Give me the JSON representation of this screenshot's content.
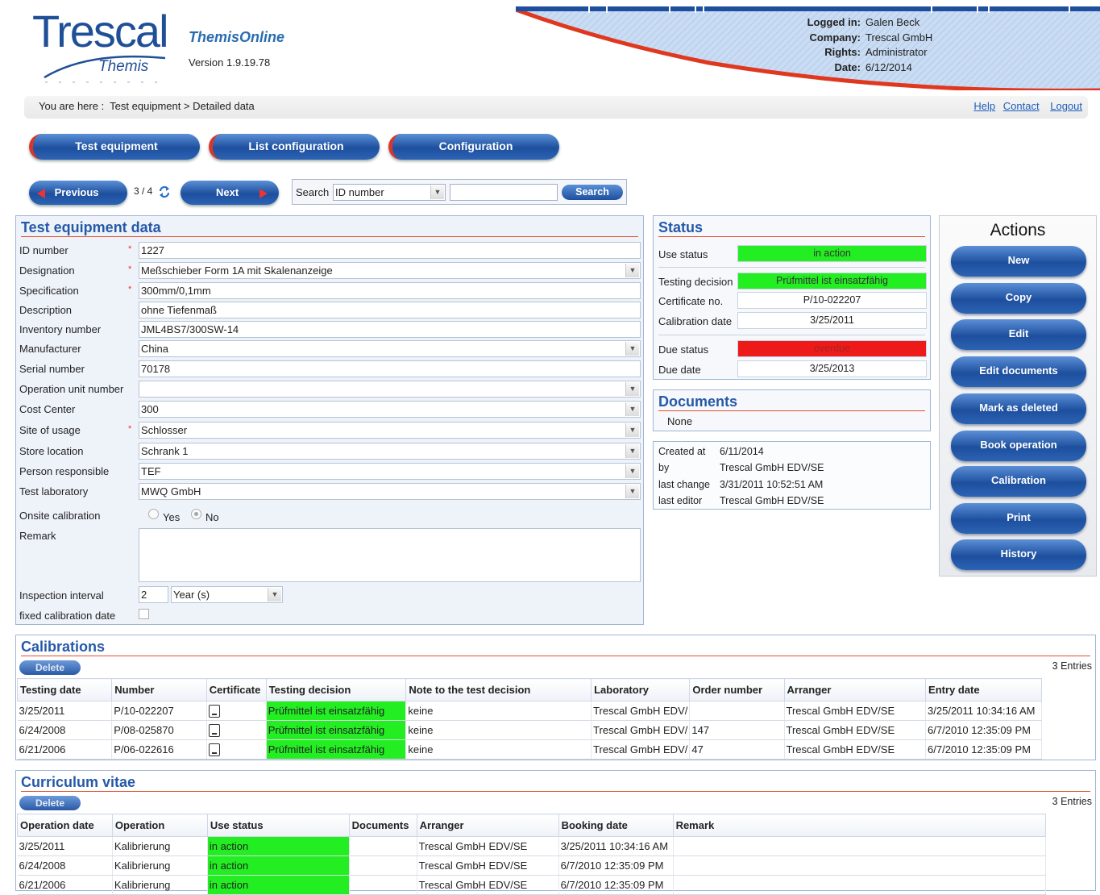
{
  "header": {
    "logo_text": "Trescal",
    "logo_sub": "Themis",
    "app_name": "ThemisOnline",
    "version": "Version 1.9.19.78",
    "user_info": [
      {
        "label": "Logged in:",
        "value": "Galen Beck"
      },
      {
        "label": "Company:",
        "value": "Trescal GmbH"
      },
      {
        "label": "Rights:",
        "value": "Administrator"
      },
      {
        "label": "Date:",
        "value": "6/12/2014"
      }
    ],
    "breadcrumb": "You are here :  Test equipment > Detailed data",
    "links": {
      "help": "Help",
      "contact": "Contact",
      "logout": "Logout"
    }
  },
  "nav": {
    "tabs": [
      "Test equipment",
      "List configuration",
      "Configuration"
    ]
  },
  "pager": {
    "previous": "Previous",
    "position": "3 / 4",
    "next": "Next",
    "search_label": "Search",
    "search_field": "ID number",
    "search_value": "",
    "search_button": "Search"
  },
  "equipment": {
    "title": "Test equipment data",
    "fields": [
      {
        "label": "ID number",
        "value": "1227"
      },
      {
        "label": "Designation",
        "value": "Meßschieber Form 1A mit Skalenanzeige"
      },
      {
        "label": "Specification",
        "value": "300mm/0,1mm"
      },
      {
        "label": "Description",
        "value": "ohne Tiefenmaß"
      },
      {
        "label": "Inventory number",
        "value": "JML4BS7/300SW-14"
      },
      {
        "label": "Manufacturer",
        "value": "China"
      },
      {
        "label": "Serial number",
        "value": "70178"
      },
      {
        "label": "Operation unit number",
        "value": ""
      },
      {
        "label": "Cost Center",
        "value": "300"
      },
      {
        "label": "Site of usage",
        "value": "Schlosser"
      },
      {
        "label": "Store location",
        "value": "Schrank 1"
      },
      {
        "label": "Person responsible",
        "value": "TEF"
      },
      {
        "label": "Test laboratory",
        "value": "MWQ GmbH"
      }
    ],
    "onsite_label": "Onsite calibration",
    "onsite_yes": "Yes",
    "onsite_no": "No",
    "remark_label": "Remark",
    "remark_value": "",
    "interval_label": "Inspection interval",
    "interval_value": "2",
    "interval_unit": "Year (s)",
    "fixed_label": "fixed calibration date"
  },
  "status": {
    "title": "Status",
    "use_status_label": "Use status",
    "use_status": "in action",
    "testing_decision_label": "Testing decision",
    "testing_decision": "Prüfmittel ist einsatzfähig",
    "certificate_label": "Certificate no.",
    "certificate": "P/10-022207",
    "calibration_date_label": "Calibration date",
    "calibration_date": "3/25/2011",
    "due_status_label": "Due status",
    "due_status": "overdue",
    "due_date_label": "Due date",
    "due_date": "3/25/2013",
    "colors": {
      "ok": "#22ee22",
      "overdue": "#ee1a1a"
    }
  },
  "documents": {
    "title": "Documents",
    "value": "None"
  },
  "meta": {
    "created_label": "Created at",
    "created": "6/11/2014",
    "by_label": "by",
    "by": "Trescal GmbH EDV/SE",
    "last_change_label": "last change",
    "last_change": "3/31/2011 10:52:51 AM",
    "last_editor_label": "last editor",
    "last_editor": "Trescal GmbH EDV/SE"
  },
  "actions": {
    "title": "Actions",
    "buttons": [
      "New",
      "Copy",
      "Edit",
      "Edit documents",
      "Mark as deleted",
      "Book operation",
      "Calibration",
      "Print",
      "History"
    ]
  },
  "calibrations": {
    "title": "Calibrations",
    "delete": "Delete",
    "entries": "3 Entries",
    "columns": [
      "Testing date",
      "Number",
      "Certificate",
      "Testing decision",
      "Note to the test decision",
      "Laboratory",
      "Order number",
      "Arranger",
      "Entry date"
    ],
    "rows": [
      [
        "3/25/2011",
        "P/10-022207",
        "",
        "Prüfmittel ist einsatzfähig",
        "keine",
        "Trescal GmbH EDV/",
        "",
        "Trescal GmbH EDV/SE",
        "3/25/2011 10:34:16 AM"
      ],
      [
        "6/24/2008",
        "P/08-025870",
        "",
        "Prüfmittel ist einsatzfähig",
        "keine",
        "Trescal GmbH EDV/",
        "147",
        "Trescal GmbH EDV/SE",
        "6/7/2010 12:35:09 PM"
      ],
      [
        "6/21/2006",
        "P/06-022616",
        "",
        "Prüfmittel ist einsatzfähig",
        "keine",
        "Trescal GmbH EDV/",
        "47",
        "Trescal GmbH EDV/SE",
        "6/7/2010 12:35:09 PM"
      ]
    ]
  },
  "cv": {
    "title": "Curriculum vitae",
    "delete": "Delete",
    "entries": "3 Entries",
    "columns": [
      "Operation date",
      "Operation",
      "Use status",
      "Documents",
      "Arranger",
      "Booking date",
      "Remark"
    ],
    "rows": [
      [
        "3/25/2011",
        "Kalibrierung",
        "in action",
        "",
        "Trescal GmbH EDV/SE",
        "3/25/2011 10:34:16 AM",
        ""
      ],
      [
        "6/24/2008",
        "Kalibrierung",
        "in action",
        "",
        "Trescal GmbH EDV/SE",
        "6/7/2010 12:35:09 PM",
        ""
      ],
      [
        "6/21/2006",
        "Kalibrierung",
        "in action",
        "",
        "Trescal GmbH EDV/SE",
        "6/7/2010 12:35:09 PM",
        ""
      ]
    ]
  }
}
